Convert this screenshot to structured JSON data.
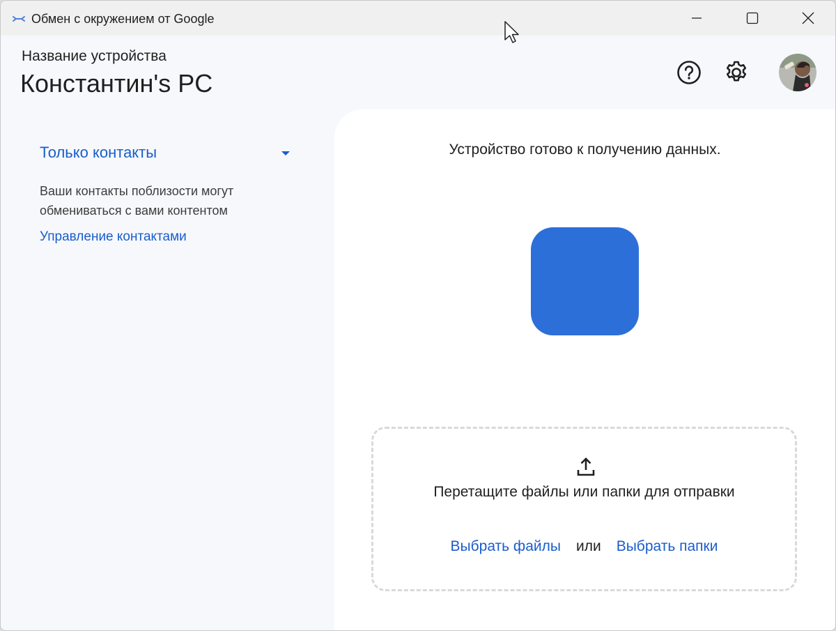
{
  "window": {
    "title": "Обмен с окружением от Google",
    "icon": "nearby-share-icon"
  },
  "header": {
    "device_label": "Название устройства",
    "device_name": "Константин's PC",
    "help_icon": "help-circle-icon",
    "settings_icon": "gear-icon"
  },
  "sidebar": {
    "visibility": "Только контакты",
    "visibility_description": "Ваши контакты поблизости могут обмениваться с вами контентом",
    "manage_link": "Управление контактами"
  },
  "main": {
    "status": "Устройство готово к получению данных.",
    "tile_color": "#2d6fd8",
    "drop_text": "Перетащите файлы или папки для отправки",
    "choose_files": "Выбрать файлы",
    "or": "или",
    "choose_folders": "Выбрать папки"
  },
  "colors": {
    "accent": "#1a5dcc",
    "background": "#f6f8fc",
    "panel": "#ffffff"
  }
}
